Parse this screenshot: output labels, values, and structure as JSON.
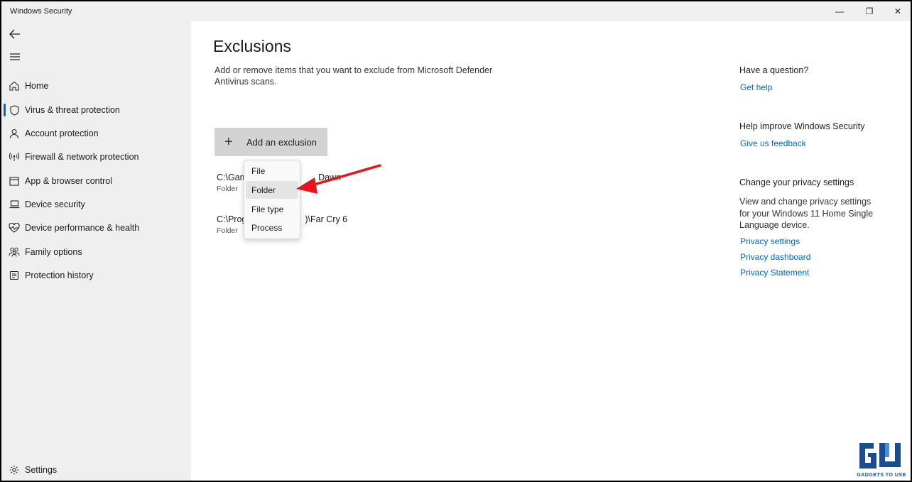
{
  "window": {
    "title": "Windows Security",
    "minimize_glyph": "—",
    "maximize_glyph": "❐",
    "close_glyph": "✕"
  },
  "sidebar": {
    "items": [
      {
        "label": "Home",
        "icon": "home-icon"
      },
      {
        "label": "Virus & threat protection",
        "icon": "shield-icon",
        "active": true
      },
      {
        "label": "Account protection",
        "icon": "person-icon"
      },
      {
        "label": "Firewall & network protection",
        "icon": "wifi-antenna-icon"
      },
      {
        "label": "App & browser control",
        "icon": "app-window-icon"
      },
      {
        "label": "Device security",
        "icon": "laptop-icon"
      },
      {
        "label": "Device performance & health",
        "icon": "heart-pulse-icon"
      },
      {
        "label": "Family options",
        "icon": "family-icon"
      },
      {
        "label": "Protection history",
        "icon": "history-icon"
      }
    ],
    "settings_label": "Settings"
  },
  "main": {
    "title": "Exclusions",
    "description": "Add or remove items that you want to exclude from Microsoft Defender Antivirus scans.",
    "add_button_label": "Add an exclusion",
    "add_button_glyph": "+",
    "exclusions": [
      {
        "path": "C:\\Gam",
        "path_tail": "Dawn",
        "type": "Folder"
      },
      {
        "path": "C:\\Prog",
        "path_tail": ")\\Far Cry 6",
        "type": "Folder"
      }
    ],
    "dropdown": {
      "options": [
        "File",
        "Folder",
        "File type",
        "Process"
      ],
      "hovered": "Folder"
    }
  },
  "right_panel": {
    "question_heading": "Have a question?",
    "get_help": "Get help",
    "improve_heading": "Help improve Windows Security",
    "feedback": "Give us feedback",
    "privacy_heading": "Change your privacy settings",
    "privacy_text": "View and change privacy settings for your Windows 11 Home Single Language device.",
    "privacy_settings": "Privacy settings",
    "privacy_dashboard": "Privacy dashboard",
    "privacy_statement": "Privacy Statement"
  },
  "watermark": {
    "text": "GADGETS TO USE"
  },
  "colors": {
    "accent": "#0067c0",
    "annotation_arrow": "#e8141c",
    "sidebar_bg": "#efefef",
    "button_bg": "#d3d3d3"
  }
}
